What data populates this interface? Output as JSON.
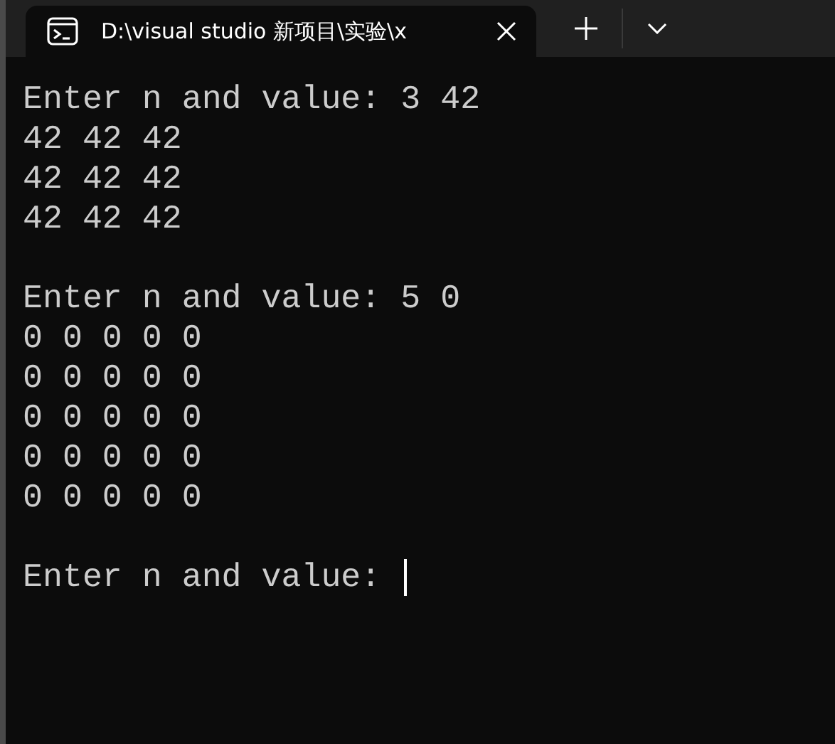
{
  "tab": {
    "title": "D:\\visual studio 新项目\\实验\\x",
    "selected": true
  },
  "terminal": {
    "blocks": [
      [
        "Enter n and value: 3 42",
        "42 42 42",
        "42 42 42",
        "42 42 42"
      ],
      [
        "Enter n and value: 5 0",
        "0 0 0 0 0",
        "0 0 0 0 0",
        "0 0 0 0 0",
        "0 0 0 0 0",
        "0 0 0 0 0"
      ],
      [
        "Enter n and value: "
      ]
    ],
    "cursor": true
  }
}
